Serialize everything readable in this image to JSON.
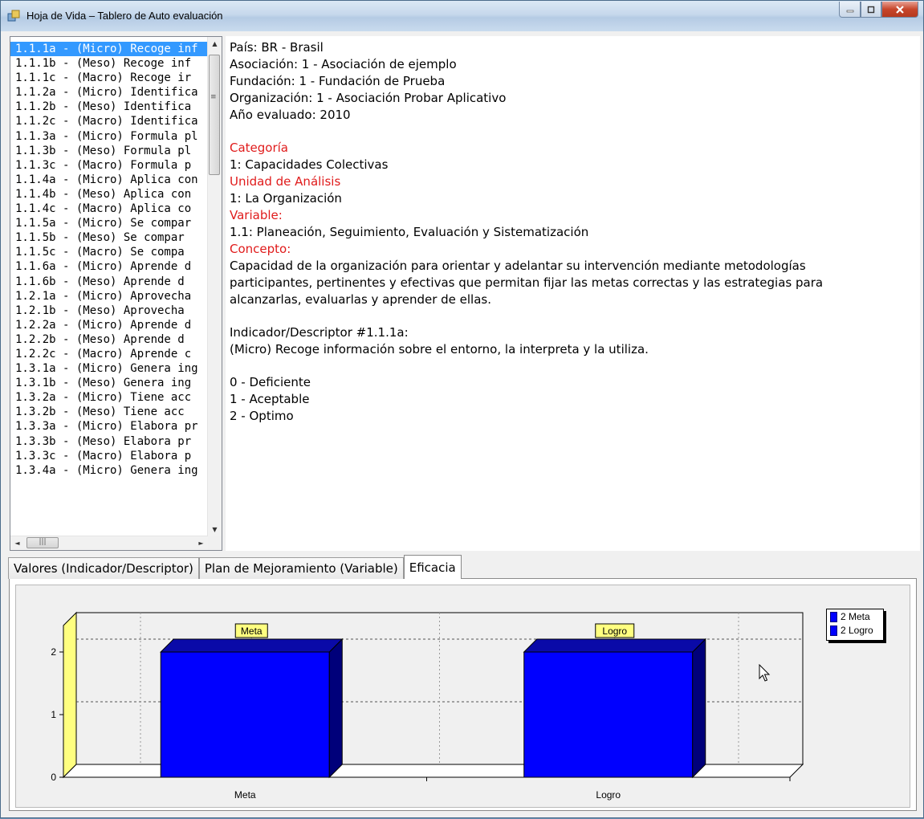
{
  "window": {
    "title": "Hoja de Vida – Tablero de Auto evaluación",
    "minimize_icon": "minimize-icon",
    "maximize_icon": "maximize-icon",
    "close_icon": "close-icon"
  },
  "list": {
    "items": [
      "1.1.1a - (Micro) Recoge inf",
      "1.1.1b - (Meso) Recoge inf",
      "1.1.1c - (Macro) Recoge ir",
      "1.1.2a - (Micro) Identifica",
      "1.1.2b - (Meso) Identifica",
      "1.1.2c - (Macro) Identifica",
      "1.1.3a - (Micro) Formula pl",
      "1.1.3b - (Meso) Formula pl",
      "1.1.3c - (Macro) Formula p",
      "1.1.4a - (Micro) Aplica con",
      "1.1.4b - (Meso) Aplica con",
      "1.1.4c - (Macro) Aplica co",
      "1.1.5a - (Micro) Se compar",
      "1.1.5b - (Meso) Se compar",
      "1.1.5c - (Macro) Se compa",
      "1.1.6a - (Micro) Aprende d",
      "1.1.6b - (Meso) Aprende d",
      "1.2.1a - (Micro) Aprovecha",
      "1.2.1b - (Meso) Aprovecha",
      "1.2.2a - (Micro) Aprende d",
      "1.2.2b - (Meso) Aprende d",
      "1.2.2c - (Macro) Aprende c",
      "1.3.1a - (Micro) Genera ing",
      "1.3.1b - (Meso) Genera ing",
      "1.3.2a - (Micro) Tiene acc",
      "1.3.2b - (Meso) Tiene acc",
      "1.3.3a - (Micro) Elabora pr",
      "1.3.3b - (Meso) Elabora pr",
      "1.3.3c - (Macro) Elabora p",
      "1.3.4a - (Micro) Genera ing"
    ],
    "selected_index": 0
  },
  "details": {
    "pais": "País: BR - Brasil",
    "asociacion": "Asociación: 1 - Asociación de ejemplo",
    "fundacion": "Fundación: 1 - Fundación de Prueba",
    "organizacion": "Organización: 1 - Asociación Probar Aplicativo",
    "anio": "Año evaluado: 2010",
    "categoria_label": "Categoría",
    "categoria_value": "1: Capacidades Colectivas",
    "unidad_label": "Unidad de Análisis",
    "unidad_value": "1: La Organización",
    "variable_label": "Variable:",
    "variable_value": "1.1: Planeación, Seguimiento, Evaluación y Sistematización",
    "concepto_label": "Concepto:",
    "concepto_line1": "Capacidad de la organización para orientar y adelantar su intervención mediante metodologías",
    "concepto_line2": "participantes, pertinentes y efectivas que permitan fijar las metas correctas y las estrategias para",
    "concepto_line3": "alcanzarlas, evaluarlas y aprender de ellas.",
    "indicador_label": "Indicador/Descriptor #1.1.1a:",
    "indicador_value": "(Micro) Recoge información sobre el entorno, la interpreta y la utiliza.",
    "escala": [
      "0 - Deficiente",
      "1 - Aceptable",
      "2 - Optimo"
    ]
  },
  "tabs": [
    {
      "label": "Valores (Indicador/Descriptor)",
      "active": false
    },
    {
      "label": "Plan de Mejoramiento (Variable)",
      "active": false
    },
    {
      "label": "Eficacia",
      "active": true
    }
  ],
  "colors": {
    "bar_face": "#0000ff",
    "bar_dark": "#00007a",
    "bar_top": "#0a0aa8",
    "label_red": "#e01b1b",
    "wall_yellow": "#ffff80"
  },
  "chart_data": {
    "type": "bar",
    "categories": [
      "Meta",
      "Logro"
    ],
    "values": [
      2,
      2
    ],
    "mark_labels": [
      "Meta",
      "Logro"
    ],
    "ylim": [
      0,
      2.5
    ],
    "yticks": [
      0,
      1,
      2
    ],
    "grid": true,
    "legend": {
      "position": "top-right",
      "entries": [
        "2 Meta",
        "2 Logro"
      ]
    }
  }
}
